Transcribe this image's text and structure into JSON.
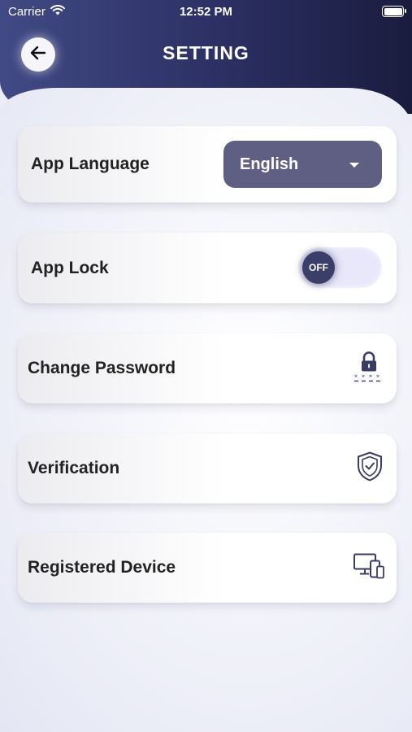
{
  "status_bar": {
    "carrier": "Carrier",
    "time": "12:52 PM",
    "icons": [
      "wifi-icon",
      "battery-icon"
    ]
  },
  "header": {
    "title": "SETTING",
    "back_icon": "arrow-left-icon"
  },
  "settings": {
    "language": {
      "label": "App Language",
      "value": "English",
      "icon": "chevron-down-icon"
    },
    "app_lock": {
      "label": "App Lock",
      "toggle_text": "OFF",
      "enabled": false
    },
    "change_password": {
      "label": "Change Password",
      "icon": "lock-password-icon"
    },
    "verification": {
      "label": "Verification",
      "icon": "shield-check-icon"
    },
    "registered_device": {
      "label": "Registered Device",
      "icon": "devices-icon"
    }
  },
  "colors": {
    "header_dark": "#1a1c3e",
    "header_light": "#414a85",
    "accent": "#5e5f83",
    "toggle_knob": "#3c3e6a",
    "icon": "#3a3c66"
  }
}
